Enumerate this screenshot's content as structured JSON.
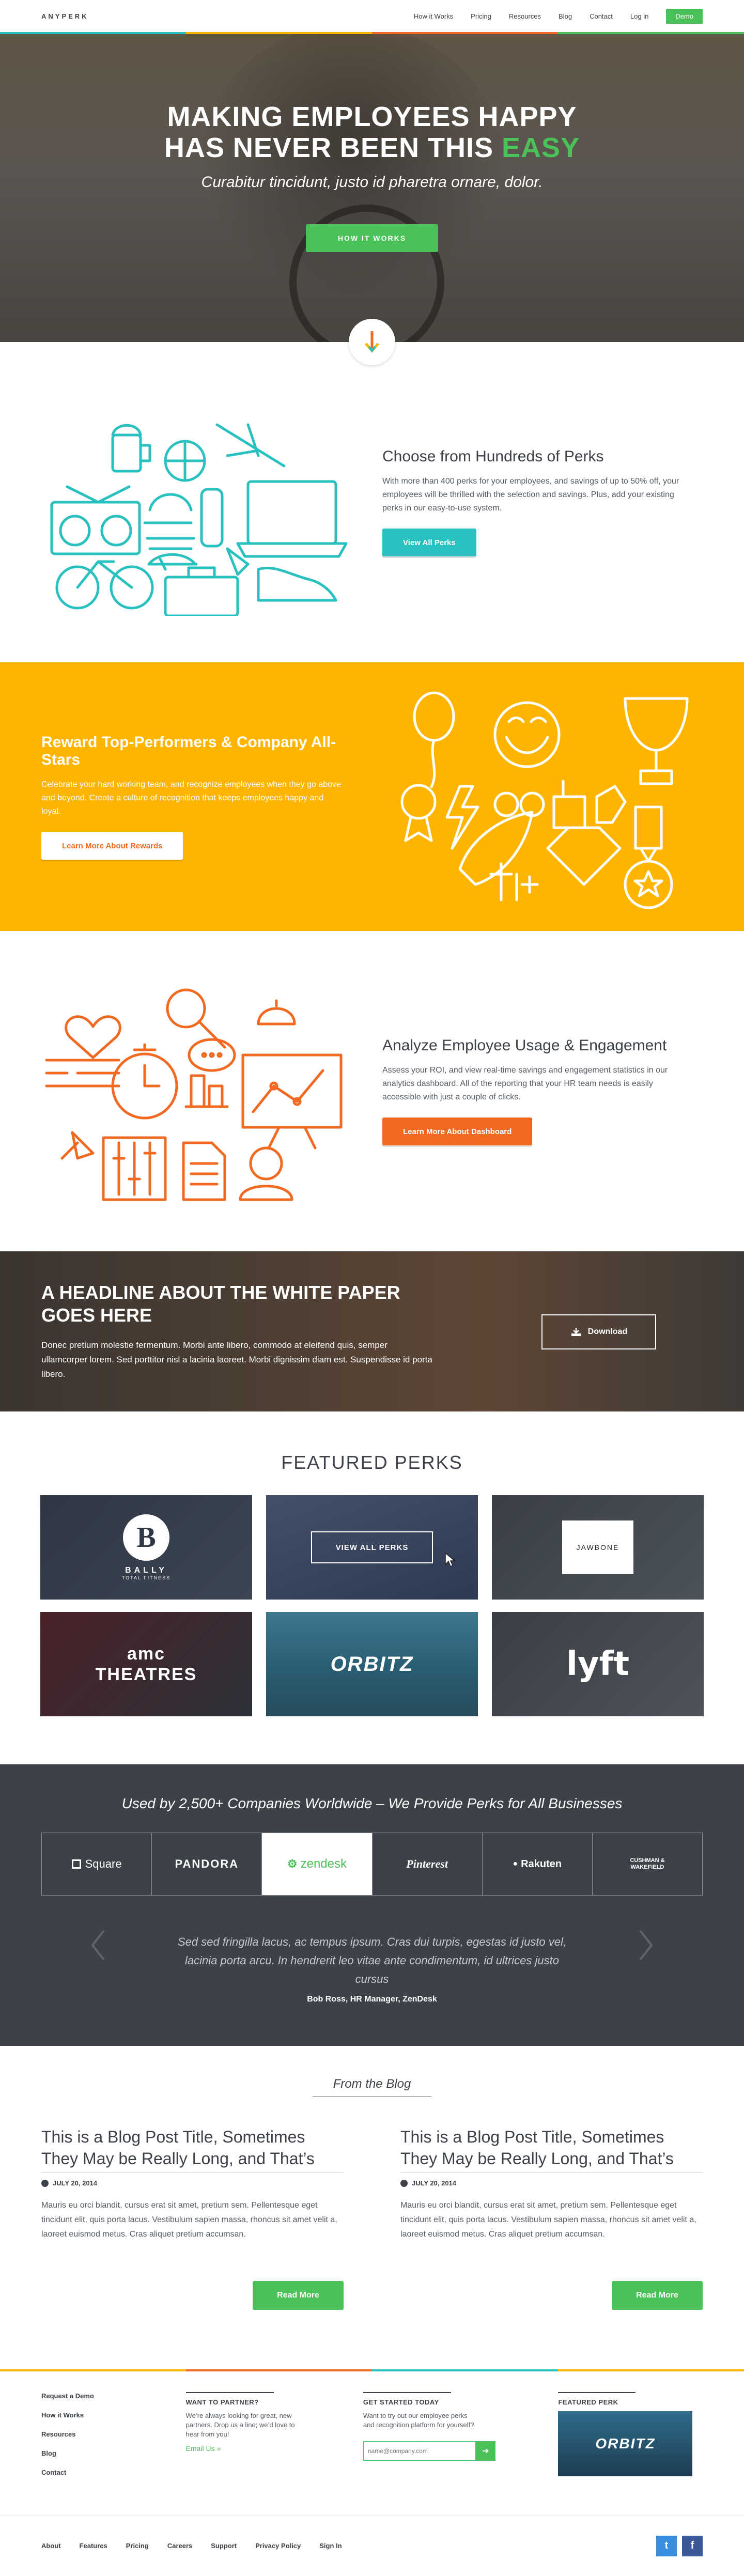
{
  "header": {
    "logo": "ANYPERK",
    "nav": [
      "How it Works",
      "Pricing",
      "Resources",
      "Blog",
      "Contact",
      "Log in"
    ],
    "demo": "Demo"
  },
  "hero": {
    "line1": "MAKING EMPLOYEES HAPPY",
    "line2": "HAS NEVER BEEN THIS",
    "highlight": "EASY",
    "subtitle": "Curabitur tincidunt, justo id pharetra ornare, dolor.",
    "cta": "HOW IT WORKS"
  },
  "features": [
    {
      "title": "Choose from Hundreds of Perks",
      "body": "With more than 400 perks for your employees, and savings of up to 50% off, your employees will be thrilled with the selection and savings. Plus, add your existing perks in our easy-to-use system.",
      "button": "View All Perks"
    },
    {
      "title": "Reward Top-Performers & Company All-Stars",
      "body": "Celebrate your hard working team, and recognize employees when they go above and beyond. Create a culture of recognition that keeps employees happy and loyal.",
      "button": "Learn More About Rewards"
    },
    {
      "title": "Analyze Employee Usage & Engagement",
      "body": "Assess your ROI, and view real-time savings and engagement statistics in our analytics dashboard. All of the reporting that your HR team needs is easily accessible with just a couple of clicks.",
      "button": "Learn More About Dashboard"
    }
  ],
  "whitepaper": {
    "title": "A HEADLINE ABOUT THE WHITE PAPER GOES HERE",
    "body": "Donec pretium molestie fermentum. Morbi ante libero, commodo at eleifend quis, semper ullamcorper lorem. Sed porttitor nisl a lacinia laoreet. Morbi dignissim diam est. Suspendisse id porta libero.",
    "button": "Download"
  },
  "perks": {
    "title": "FEATURED PERKS",
    "tiles": [
      "BALLY",
      "VIEW ALL PERKS",
      "JAWBONE",
      "amc THEATRES",
      "ORBITZ",
      "lyft"
    ],
    "bally_sub": "TOTAL FITNESS"
  },
  "clients": {
    "title": "Used by 2,500+ Companies Worldwide – We Provide Perks for All Businesses",
    "logos": [
      "Square",
      "PANDORA",
      "zendesk",
      "Pinterest",
      "Rakuten",
      "CUSHMAN & WAKEFIELD"
    ],
    "quote": "Sed sed fringilla lacus, ac tempus ipsum. Cras dui turpis, egestas id justo vel, lacinia porta arcu. In hendrerit leo vitae ante condimentum, id ultrices justo cursus",
    "attribution": "Bob Ross, HR Manager, ZenDesk"
  },
  "blog": {
    "heading": "From the Blog",
    "posts": [
      {
        "title": "This is a Blog Post Title, Sometimes They May be Really Long, and That’s",
        "date": "JULY 20, 2014",
        "excerpt": "Mauris eu orci blandit, cursus erat sit amet, pretium sem. Pellentesque eget tincidunt elit, quis porta lacus. Vestibulum sapien massa, rhoncus sit amet velit a, laoreet euismod metus. Cras aliquet pretium accumsan.",
        "button": "Read More"
      },
      {
        "title": "This is a Blog Post Title, Sometimes They May be Really Long, and That’s",
        "date": "JULY 20, 2014",
        "excerpt": "Mauris eu orci blandit, cursus erat sit amet, pretium sem. Pellentesque eget tincidunt elit, quis porta lacus. Vestibulum sapien massa, rhoncus sit amet velit a, laoreet euismod metus. Cras aliquet pretium accumsan.",
        "button": "Read More"
      }
    ]
  },
  "footer": {
    "links": [
      "Request a Demo",
      "How it Works",
      "Resources",
      "Blog",
      "Contact"
    ],
    "partner": {
      "heading": "WANT TO PARTNER?",
      "body": "We’re always looking for great, new partners. Drop us a line; we’d love to hear from you!",
      "email": "Email Us »"
    },
    "started": {
      "heading": "GET STARTED TODAY",
      "body": "Want to try out our employee perks and recognition platform for yourself?",
      "placeholder": "name@company.com"
    },
    "featured": {
      "heading": "FEATURED PERK",
      "perk": "ORBITZ"
    },
    "bottom_links": [
      "About",
      "Features",
      "Pricing",
      "Careers",
      "Support",
      "Privacy Policy",
      "Sign In"
    ],
    "social": [
      "twitter-icon",
      "facebook-icon"
    ]
  },
  "colors": {
    "green": "#4bc159",
    "yellow": "#ffb400",
    "teal": "#28c1c0",
    "orange": "#f26a22",
    "dark": "#3d4148"
  }
}
